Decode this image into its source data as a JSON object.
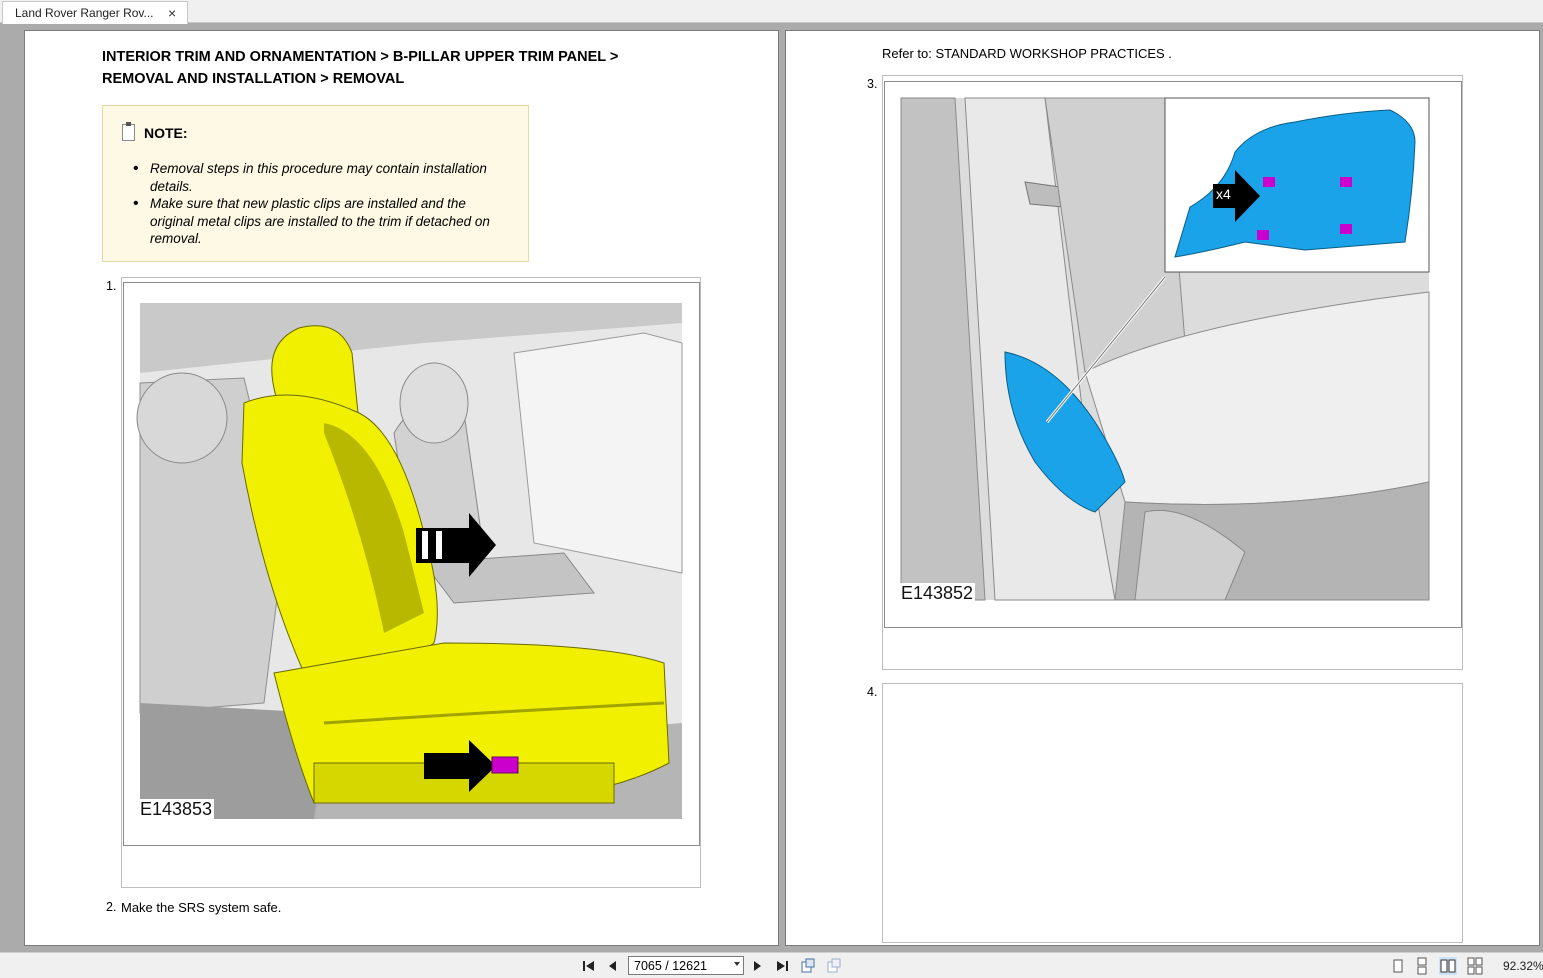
{
  "tab": {
    "title": "Land Rover Ranger Rov...",
    "close": "×"
  },
  "left_page": {
    "heading": "INTERIOR TRIM AND ORNAMENTATION > B-PILLAR UPPER TRIM PANEL > REMOVAL AND INSTALLATION > REMOVAL",
    "note": {
      "title": "NOTE:",
      "items": [
        "Removal steps in this procedure may contain installation details.",
        "Make sure that new plastic clips are installed and the original metal clips are installed to the trim if detached on removal."
      ]
    },
    "step1": {
      "number": "1.",
      "figure_code": "E143853"
    },
    "step2": {
      "number": "2.",
      "text": "Make the SRS system safe."
    }
  },
  "right_page": {
    "refer": "Refer to: STANDARD WORKSHOP PRACTICES .",
    "step3": {
      "number": "3.",
      "figure_code": "E143852",
      "callout": "x4"
    },
    "step4": {
      "number": "4."
    }
  },
  "toolbar": {
    "page_indicator": "7065 / 12621",
    "zoom": "92.32%",
    "icons": [
      "first-page-icon",
      "prev-page-icon",
      "next-page-icon",
      "last-page-icon",
      "prev-view-icon",
      "next-view-icon",
      "single-page-icon",
      "continuous-icon",
      "facing-icon",
      "continuous-facing-icon"
    ]
  },
  "colors": {
    "seat_yellow": "#f0f000",
    "trim_cyan": "#1aa3e8",
    "clip_magenta": "#cc00cc",
    "note_bg": "#fdf9e4"
  }
}
